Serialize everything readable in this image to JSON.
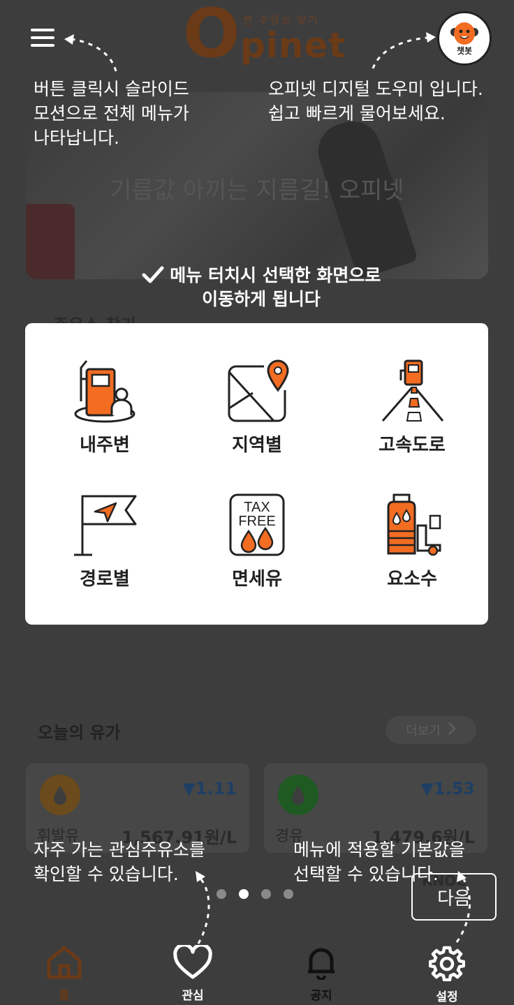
{
  "app": {
    "logo_sub": "싼 주유소 찾기",
    "logo_o": "O",
    "logo_rest": "pinet",
    "banner_text": "기름값 아끼는 지름길! 오피넷",
    "section_title": "주유소 찾기",
    "chatbot_label": "챗봇"
  },
  "oil_price": {
    "title": "오늘의 유가",
    "more_label": "더보기",
    "cards": [
      {
        "name": "휘발유",
        "change": "▼1.11",
        "price": "1,567.91원/L",
        "color": "#6b4a1c"
      },
      {
        "name": "경유",
        "change": "▼1.53",
        "price": "1,479.6원/L",
        "color": "#1f5a22"
      }
    ],
    "provider": "KNOC"
  },
  "menu": {
    "items": [
      {
        "label": "내주변",
        "icon": "gas-station-nearby-icon"
      },
      {
        "label": "지역별",
        "icon": "map-pin-icon"
      },
      {
        "label": "고속도로",
        "icon": "highway-icon"
      },
      {
        "label": "경로별",
        "icon": "route-flag-icon"
      },
      {
        "label": "면세유",
        "icon": "tax-free-icon"
      },
      {
        "label": "요소수",
        "icon": "urea-truck-icon"
      }
    ],
    "tax_line1": "TAX",
    "tax_line2": "FREE"
  },
  "guide": {
    "menu_hint": "버튼 클릭시 슬라이드\n모션으로 전체 메뉴가\n나타납니다.",
    "chatbot_hint": "오피넷 디지털 도우미 입니다.\n쉽고 빠르게 물어보세요.",
    "menu_touch_line1": "메뉴 터치시 선택한 화면으로",
    "menu_touch_line2": "이동하게 됩니다",
    "favorite_hint": "자주 가는 관심주유소를\n확인할 수 있습니다.",
    "settings_hint": "메뉴에 적용할 기본값을\n선택할 수 있습니다.",
    "next_label": "다음",
    "page_total": 4,
    "page_current": 2
  },
  "nav": {
    "items": [
      {
        "label": "홈",
        "icon": "home-icon"
      },
      {
        "label": "관심",
        "icon": "heart-icon"
      },
      {
        "label": "공지",
        "icon": "bell-icon"
      },
      {
        "label": "설정",
        "icon": "gear-icon"
      }
    ]
  },
  "colors": {
    "accent": "#f26c22",
    "overlay": "#3d3d3d"
  }
}
